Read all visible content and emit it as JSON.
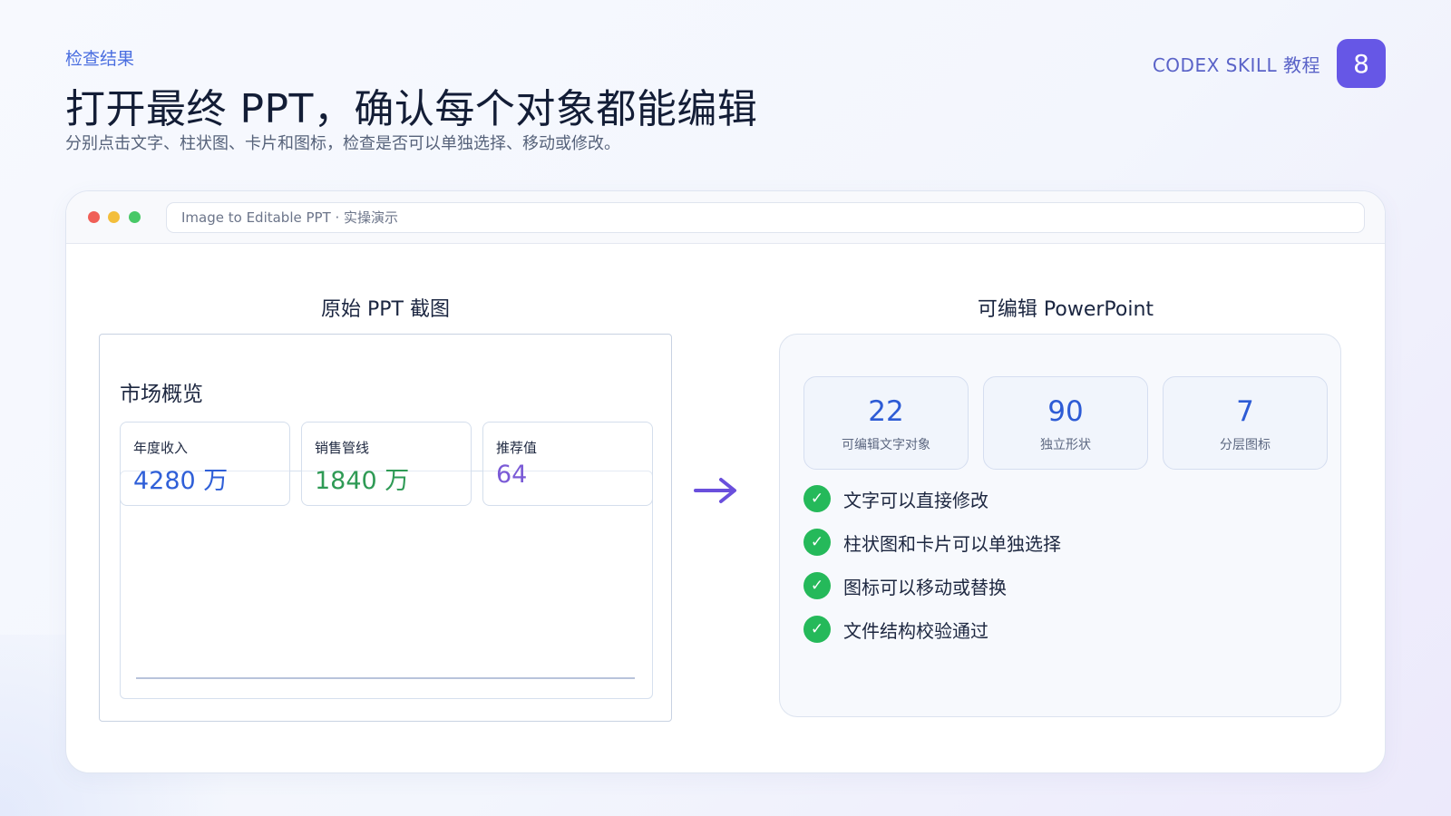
{
  "header": {
    "eyebrow": "检查结果",
    "title": "打开最终 PPT，确认每个对象都能编辑",
    "subtitle": "分别点击文字、柱状图、卡片和图标，检查是否可以单独选择、移动或修改。"
  },
  "brand": {
    "text": "CODEX SKILL 教程",
    "page_number": "8",
    "accent_color": "#6657e6"
  },
  "window": {
    "url_text": "Image to Editable PPT · 实操演示",
    "dots": [
      "red",
      "yellow",
      "green"
    ]
  },
  "original": {
    "label": "原始 PPT 截图",
    "slide_title": "市场概览",
    "cards": [
      {
        "label": "年度收入",
        "value": "4280 万",
        "color": "#2f5fd8"
      },
      {
        "label": "销售管线",
        "value": "1840 万",
        "color": "#2e9a55"
      },
      {
        "label": "推荐值",
        "value": "64",
        "color": "#7a5ad6"
      }
    ]
  },
  "arrow_icon": "arrow-right-icon",
  "editable": {
    "label": "可编辑 PowerPoint",
    "stats": [
      {
        "number": "22",
        "caption": "可编辑文字对象"
      },
      {
        "number": "90",
        "caption": "独立形状"
      },
      {
        "number": "7",
        "caption": "分层图标"
      }
    ],
    "checks": [
      {
        "icon": "check-icon",
        "mark": "✓",
        "text": "文字可以直接修改"
      },
      {
        "icon": "check-icon",
        "mark": "✓",
        "text": "柱状图和卡片可以单独选择"
      },
      {
        "icon": "check-icon",
        "mark": "✓",
        "text": "图标可以移动或替换"
      },
      {
        "icon": "check-icon",
        "mark": "✓",
        "text": "文件结构校验通过"
      }
    ]
  }
}
